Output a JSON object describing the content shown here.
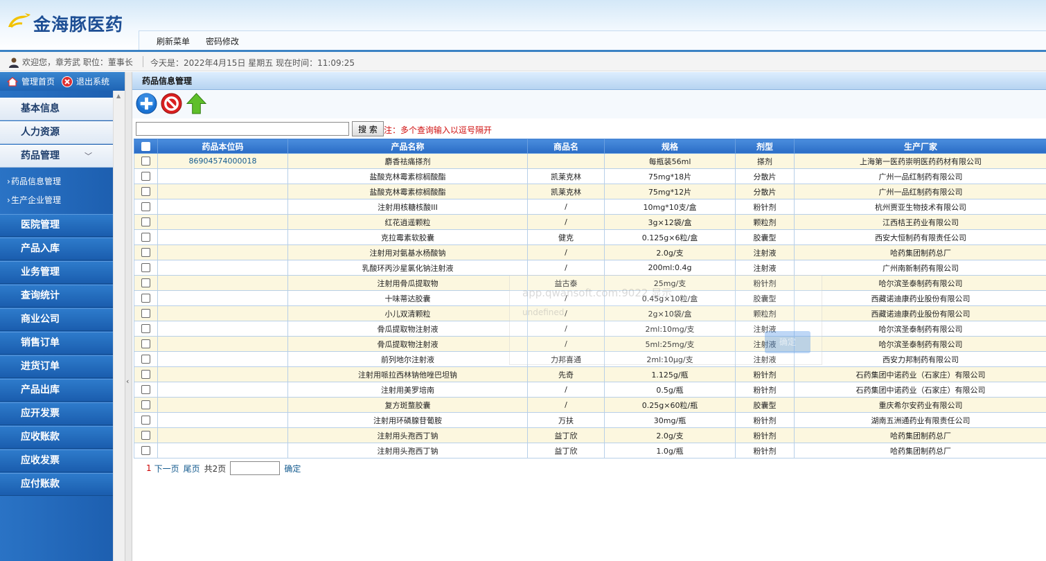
{
  "header": {
    "logo_text": "金海豚医药",
    "nav": [
      "刷新菜单",
      "密码修改"
    ]
  },
  "infobar": {
    "welcome": "欢迎您，章芳武 职位：董事长",
    "date": "今天是：2022年4月15日 星期五 现在时间：11:09:25"
  },
  "topleft": {
    "home": "管理首页",
    "logout": "退出系统"
  },
  "sidebar": {
    "menus": [
      "基本信息",
      "人力资源",
      "药品管理",
      "医院管理",
      "产品入库",
      "业务管理",
      "查询统计",
      "商业公司",
      "销售订单",
      "进货订单",
      "产品出库",
      "应开发票",
      "应收账款",
      "应收发票",
      "应付账款"
    ],
    "sub_items": [
      "药品信息管理",
      "生产企业管理"
    ]
  },
  "content": {
    "title": "药品信息管理",
    "search": {
      "value": "",
      "button": "搜 索",
      "note": "注：多个查询输入以逗号隔开"
    },
    "table": {
      "headers": [
        "药品本位码",
        "产品名称",
        "商品名",
        "规格",
        "剂型",
        "生产厂家"
      ],
      "rows": [
        [
          "86904574000018",
          "麝香祛痛搽剂",
          "",
          "每瓶装56ml",
          "搽剂",
          "上海第一医药崇明医药药材有限公司"
        ],
        [
          "",
          "盐酸克林霉素棕榈酸酯",
          "凯莱克林",
          "75mg*18片",
          "分散片",
          "广州一品红制药有限公司"
        ],
        [
          "",
          "盐酸克林霉素棕榈酸酯",
          "凯莱克林",
          "75mg*12片",
          "分散片",
          "广州一品红制药有限公司"
        ],
        [
          "",
          "注射用核糖核酸III",
          "/",
          "10mg*10支/盒",
          "粉针剂",
          "杭州贾亚生物技术有限公司"
        ],
        [
          "",
          "红花逍遥颗粒",
          "/",
          "3g×12袋/盒",
          "颗粒剂",
          "江西桔王药业有限公司"
        ],
        [
          "",
          "克拉霉素软胶囊",
          "健克",
          "0.125g×6粒/盒",
          "胶囊型",
          "西安大恒制药有限责任公司"
        ],
        [
          "",
          "注射用对氨基水杨酸钠",
          "/",
          "2.0g/支",
          "注射液",
          "哈药集团制药总厂"
        ],
        [
          "",
          "乳酸环丙沙星氯化钠注射液",
          "/",
          "200ml:0.4g",
          "注射液",
          "广州南新制药有限公司"
        ],
        [
          "",
          "注射用骨瓜提取物",
          "益古泰",
          "25mg/支",
          "粉针剂",
          "哈尔滨圣泰制药有限公司"
        ],
        [
          "",
          "十味蒂达胶囊",
          "/",
          "0.45g×10粒/盒",
          "胶囊型",
          "西藏诺迪康药业股份有限公司"
        ],
        [
          "",
          "小儿双清颗粒",
          "/",
          "2g×10袋/盒",
          "颗粒剂",
          "西藏诺迪康药业股份有限公司"
        ],
        [
          "",
          "骨瓜提取物注射液",
          "/",
          "2ml:10mg/支",
          "注射液",
          "哈尔滨圣泰制药有限公司"
        ],
        [
          "",
          "骨瓜提取物注射液",
          "/",
          "5ml:25mg/支",
          "注射液",
          "哈尔滨圣泰制药有限公司"
        ],
        [
          "",
          "前列地尔注射液",
          "力邦喜通",
          "2ml:10μg/支",
          "注射液",
          "西安力邦制药有限公司"
        ],
        [
          "",
          "注射用哌拉西林钠他唑巴坦钠",
          "先奇",
          "1.125g/瓶",
          "粉针剂",
          "石药集团中诺药业（石家庄）有限公司"
        ],
        [
          "",
          "注射用美罗培南",
          "/",
          "0.5g/瓶",
          "粉针剂",
          "石药集团中诺药业（石家庄）有限公司"
        ],
        [
          "",
          "复方斑蝥胶囊",
          "/",
          "0.25g×60粒/瓶",
          "胶囊型",
          "重庆希尔安药业有限公司"
        ],
        [
          "",
          "注射用环磷腺苷葡胺",
          "万扶",
          "30mg/瓶",
          "粉针剂",
          "湖南五洲通药业有限责任公司"
        ],
        [
          "",
          "注射用头孢西丁钠",
          "益丁欣",
          "2.0g/支",
          "粉针剂",
          "哈药集团制药总厂"
        ],
        [
          "",
          "注射用头孢西丁钠",
          "益丁欣",
          "1.0g/瓶",
          "粉针剂",
          "哈药集团制药总厂"
        ]
      ]
    },
    "pager": {
      "current": "1",
      "next": "下一页",
      "last": "尾页",
      "total": "共2页",
      "confirm": "确定"
    }
  },
  "dialog": {
    "title": "app.qwansoft.com:9022 显示",
    "message": "undefined",
    "ok": "确定"
  },
  "colors": {
    "accent": "#2a6cc5",
    "odd_row": "#fcf7df",
    "note_red": "#d01010"
  }
}
